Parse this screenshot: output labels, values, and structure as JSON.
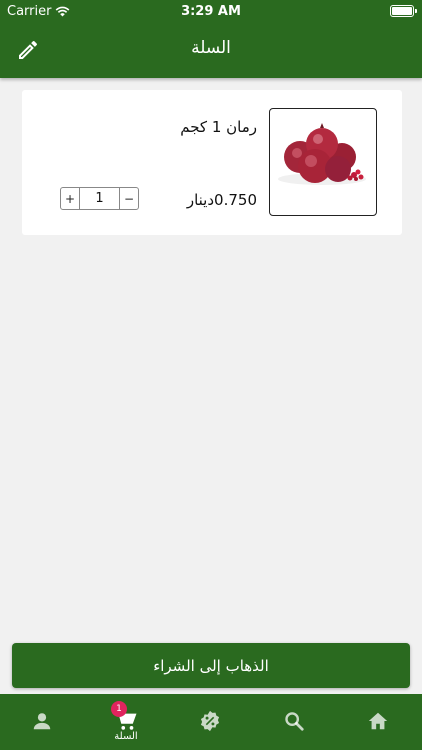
{
  "status_bar": {
    "carrier": "Carrier",
    "time": "3:29 AM"
  },
  "header": {
    "title": "السلة",
    "edit_icon": "pencil-icon"
  },
  "cart": {
    "items": [
      {
        "name": "رمان 1 كجم",
        "price": "0.750دينار",
        "quantity": "1",
        "increment_label": "+",
        "decrement_label": "−",
        "image": "pomegranate"
      }
    ]
  },
  "checkout_button": {
    "label": "الذهاب إلى الشراء"
  },
  "tabs": [
    {
      "icon": "home-icon",
      "label": ""
    },
    {
      "icon": "search-icon",
      "label": ""
    },
    {
      "icon": "discount-icon",
      "label": ""
    },
    {
      "icon": "cart-icon",
      "label": "السلة",
      "badge": "1",
      "active": true
    },
    {
      "icon": "profile-icon",
      "label": ""
    }
  ],
  "colors": {
    "primary": "#2a6a1f",
    "badge": "#e0245e",
    "background": "#f1f1f1"
  }
}
